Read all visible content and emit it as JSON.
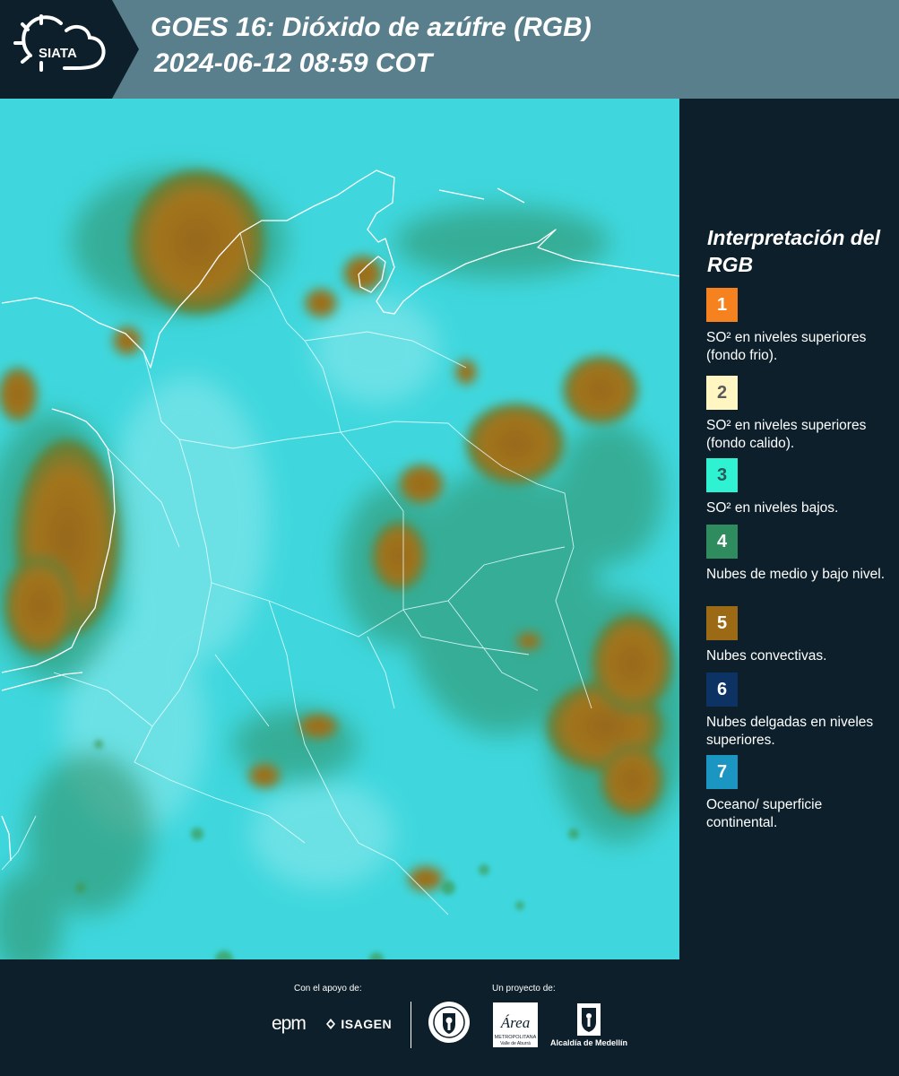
{
  "header": {
    "logo_text": "SIATA",
    "title_line1": "GOES 16: Dióxido de azúfre (RGB)",
    "title_line2": "2024-06-12 08:59 COT"
  },
  "legend": {
    "title": "Interpretación del RGB",
    "items": [
      {
        "number": "1",
        "label": "SO² en niveles superiores (fondo frio).",
        "color": "#f5821f",
        "text_color": "#ffffff"
      },
      {
        "number": "2",
        "label": "SO² en niveles superiores (fondo calido).",
        "color": "#fff6c2",
        "text_color": "#5a5a5a"
      },
      {
        "number": "3",
        "label": "SO² en niveles bajos.",
        "color": "#2ff2d2",
        "text_color": "#2a5a55"
      },
      {
        "number": "4",
        "label": "Nubes de medio y bajo nivel.",
        "color": "#2e8c5e",
        "text_color": "#ffffff"
      },
      {
        "number": "5",
        "label": "Nubes convectivas.",
        "color": "#9c6a15",
        "text_color": "#ffffff"
      },
      {
        "number": "6",
        "label": "Nubes delgadas en niveles superiores.",
        "color": "#0d3264",
        "text_color": "#ffffff"
      },
      {
        "number": "7",
        "label": "Oceano/ superficie continental.",
        "color": "#1b95c2",
        "text_color": "#ffffff"
      }
    ]
  },
  "footer": {
    "support_label": "Con el apoyo de:",
    "project_label": "Un proyecto de:",
    "epm": "epm",
    "isagen": "ISAGEN",
    "area_name": "Área",
    "area_sub1": "METROPOLITANA",
    "area_sub2": "Valle de Aburrá",
    "alcaldia": "Alcaldía de Medellín"
  },
  "colors": {
    "background": "#0c1f2a",
    "header_band": "#5a7f8c",
    "map_base": "#3fd7dd",
    "convective": "#9c6a15",
    "mid_low_cloud": "#2e8c5e"
  }
}
